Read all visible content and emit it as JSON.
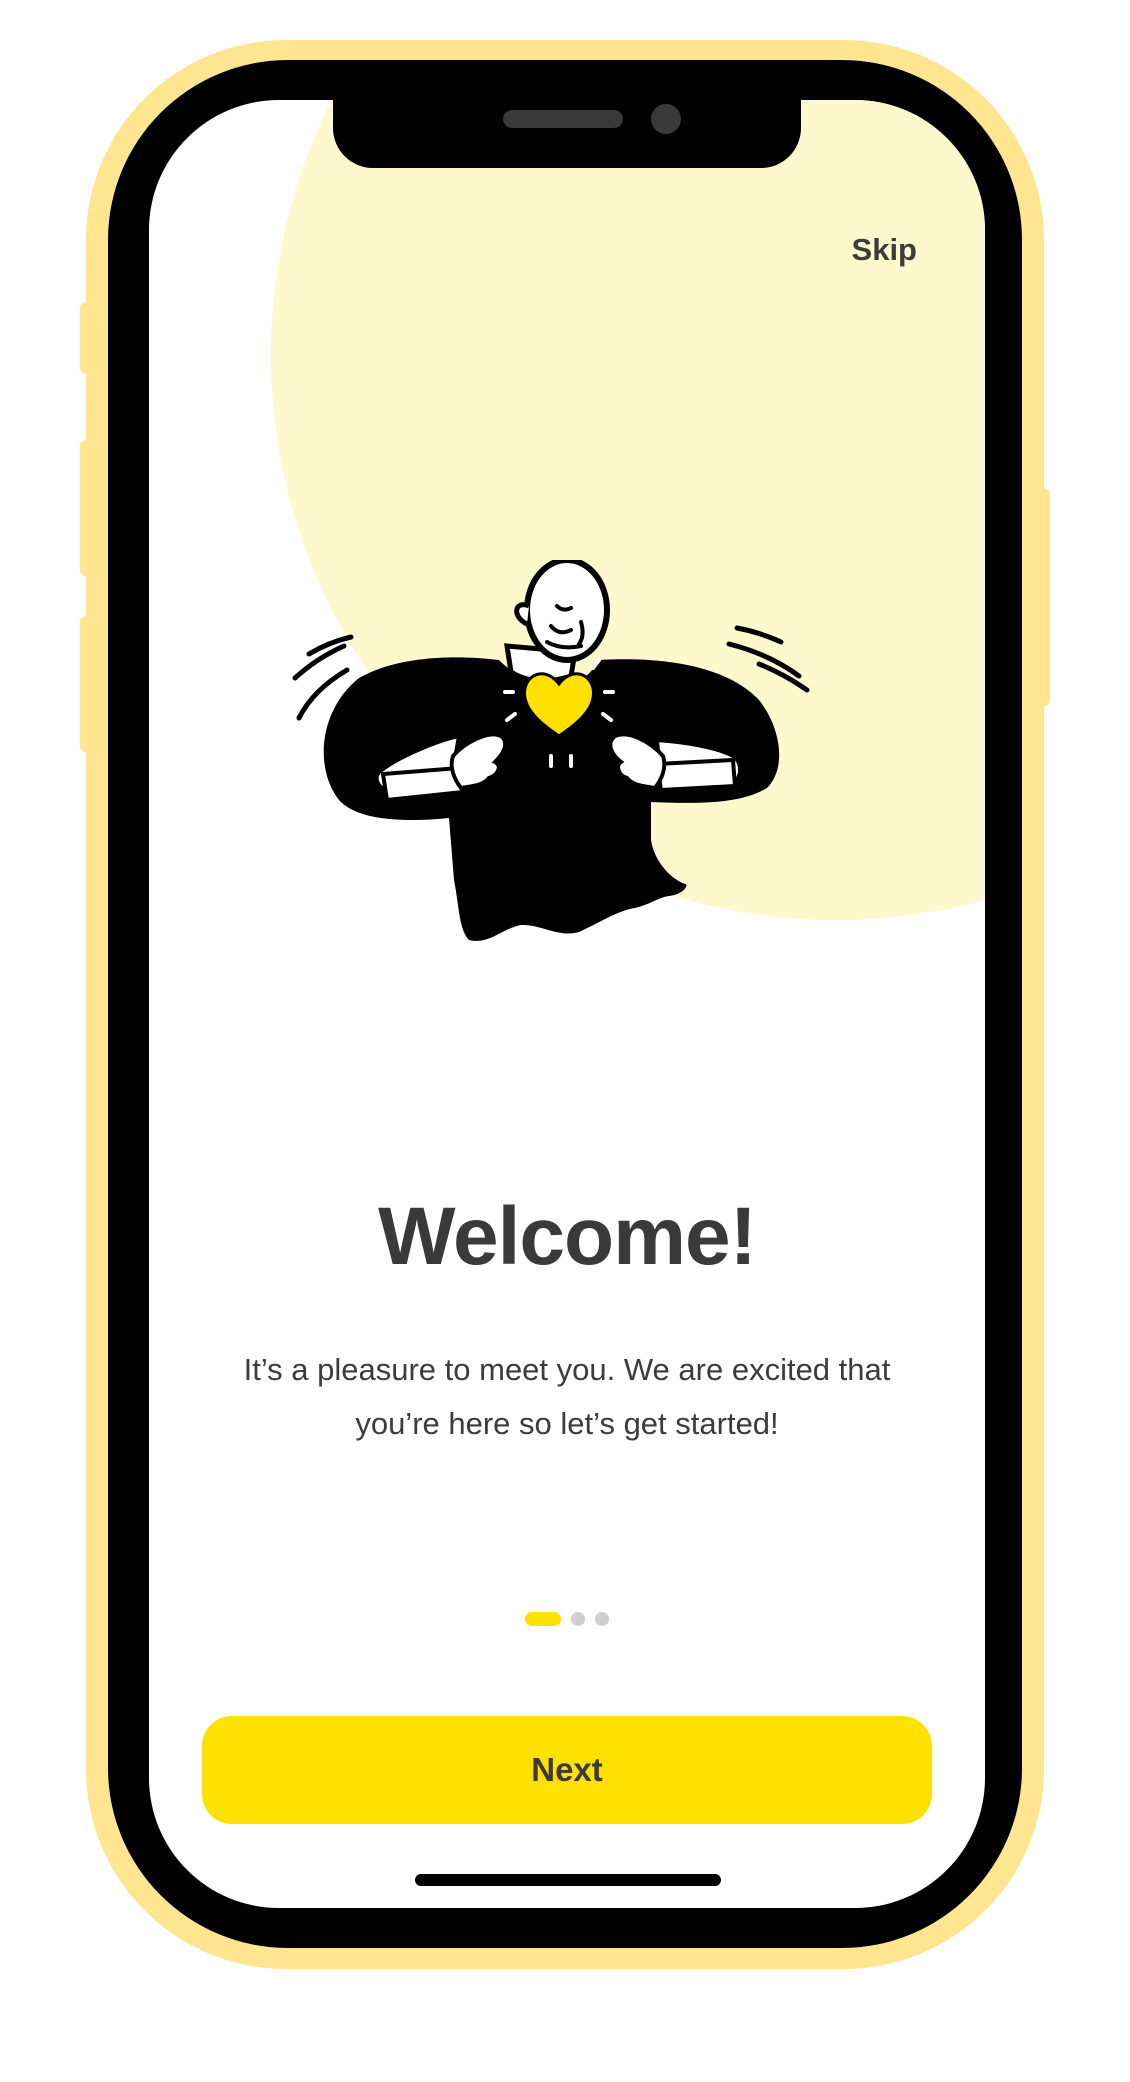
{
  "header": {
    "skip_label": "Skip"
  },
  "onboarding": {
    "title": "Welcome!",
    "description": "It’s a pleasure to meet you. We are excited that you’re here so let’s get started!",
    "page_indicator": {
      "total": 3,
      "active_index": 0
    }
  },
  "footer": {
    "next_label": "Next"
  },
  "illustration": {
    "icon": "person-holding-heart-illustration"
  },
  "colors": {
    "accent": "#ffe100",
    "accent_soft": "#fef8cd",
    "phone_frame": "#fde68f",
    "text_primary": "#3a3a3a",
    "dot_inactive": "#cfcfcf"
  }
}
